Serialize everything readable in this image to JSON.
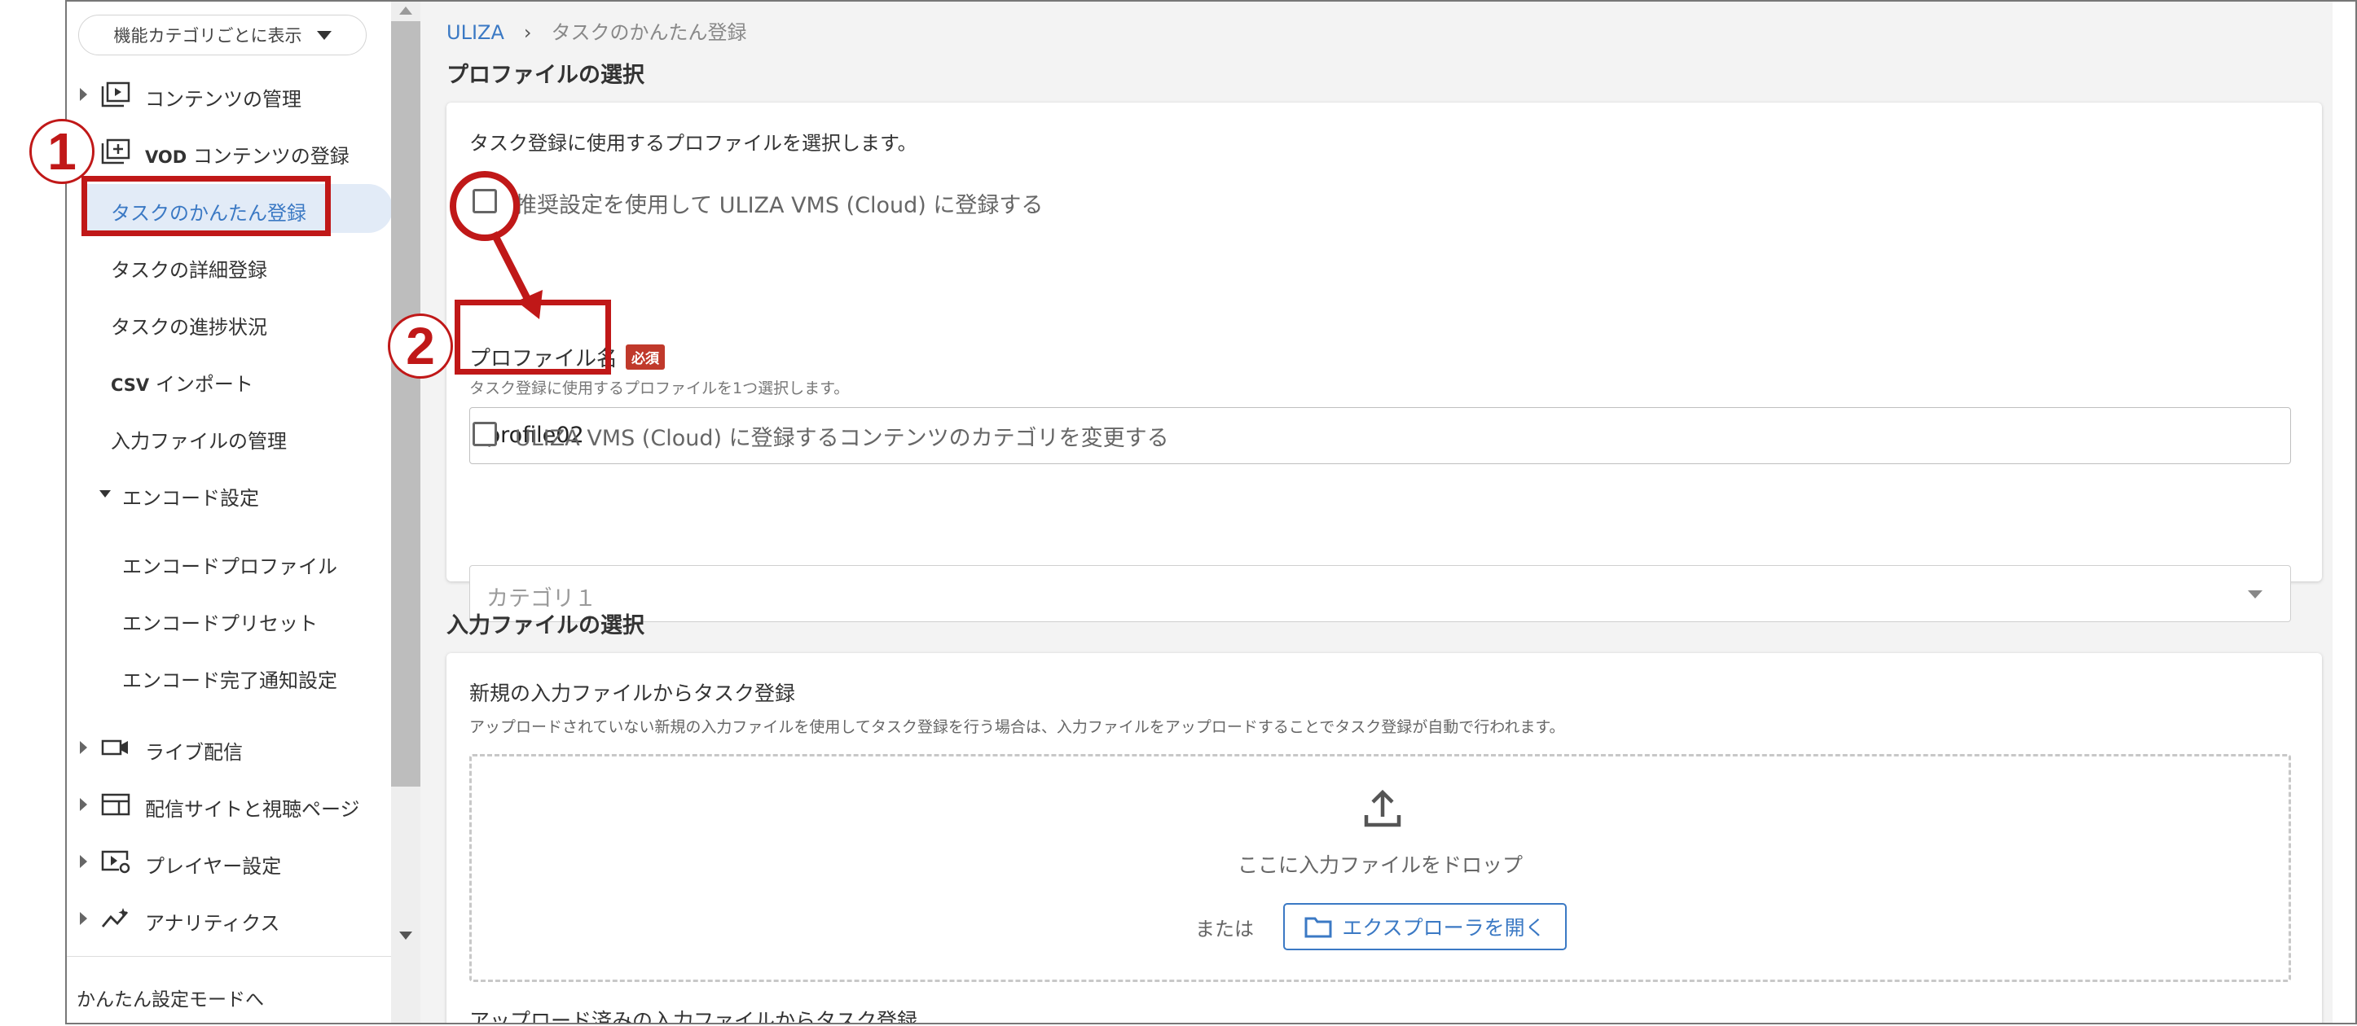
{
  "sidebar": {
    "category_select": "機能カテゴリごとに表示",
    "items": [
      {
        "label": "コンテンツの管理"
      },
      {
        "label_prefix": "VOD",
        "label": "コンテンツの登録"
      }
    ],
    "sub_items": [
      {
        "label": "タスクのかんたん登録"
      },
      {
        "label": "タスクの詳細登録"
      },
      {
        "label": "タスクの進捗状況"
      },
      {
        "label_prefix": "CSV",
        "label": "インポート"
      },
      {
        "label": "入力ファイルの管理"
      }
    ],
    "encode_group": {
      "label": "エンコード設定",
      "items": [
        {
          "label": "エンコードプロファイル"
        },
        {
          "label": "エンコードプリセット"
        },
        {
          "label": "エンコード完了通知設定"
        }
      ]
    },
    "bottom_items": [
      {
        "label": "ライブ配信"
      },
      {
        "label": "配信サイトと視聴ページ"
      },
      {
        "label": "プレイヤー設定"
      },
      {
        "label": "アナリティクス"
      }
    ],
    "footer_link": "かんたん設定モードへ"
  },
  "breadcrumb": {
    "root": "ULIZA",
    "separator": "›",
    "current": "タスクのかんたん登録"
  },
  "profile_section": {
    "title": "プロファイルの選択",
    "description": "タスク登録に使用するプロファイルを選択します。",
    "recommended_checkbox": "推奨設定を使用して ULIZA VMS (Cloud) に登録する",
    "profile_label": "プロファイル名",
    "required_badge": "必須",
    "profile_hint": "タスク登録に使用するプロファイルを1つ選択します。",
    "profile_value": "profile02",
    "category_checkbox": "ULIZA VMS (Cloud) に登録するコンテンツのカテゴリを変更する",
    "category_placeholder": "カテゴリ１"
  },
  "input_section": {
    "title": "入力ファイルの選択",
    "new_title": "新規の入力ファイルからタスク登録",
    "new_description": "アップロードされていない新規の入力ファイルを使用してタスク登録を行う場合は、入力ファイルをアップロードすることでタスク登録が自動で行われます。",
    "drop_text": "ここに入力ファイルをドロップ",
    "or_text": "または",
    "explorer_button": "エクスプローラを開く",
    "uploaded_title": "アップロード済みの入力ファイルからタスク登録"
  },
  "annotations": {
    "step1": "1",
    "step2": "2",
    "color": "#c01818"
  },
  "colors": {
    "accent": "#3b79c4",
    "active_bg": "#e2ebf7",
    "required": "#c0392b"
  }
}
